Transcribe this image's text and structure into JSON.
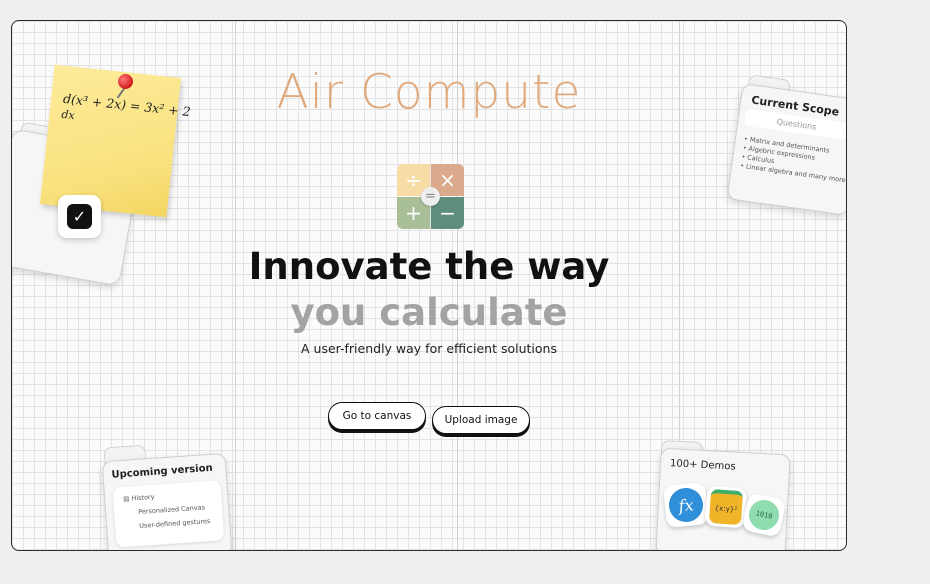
{
  "app": {
    "title": "Air Compute",
    "headline_line1": "Innovate the way",
    "headline_line2": "you calculate",
    "subtitle": "A user-friendly way  for efficient solutions"
  },
  "buttons": {
    "canvas": "Go to canvas",
    "upload": "Upload image"
  },
  "sticky_note": {
    "formula": "d(x³ + 2x) = 3x² + 2",
    "formula_den": "dx"
  },
  "logo": {
    "symbols": [
      "÷",
      "×",
      "+",
      "−",
      "="
    ]
  },
  "scope_card": {
    "title": "Current Scope",
    "tab_label": "Questions",
    "items": [
      "Matrix and determinants",
      "Algebric expressions",
      "Calculus",
      "Linear algebra and many more"
    ]
  },
  "upcoming_card": {
    "title": "Upcoming version",
    "items": [
      "History",
      "Personalized Canvas",
      "User-defined gestures"
    ]
  },
  "demos_card": {
    "title": "100+ Demos",
    "icons": [
      "fx",
      "{x:y}²",
      "1010"
    ]
  },
  "colors": {
    "title": "#dfa97c",
    "logo_q1": "#f7dca6",
    "logo_q2": "#dba98b",
    "logo_q3": "#a9bf98",
    "logo_q4": "#5f8e7e",
    "headline_secondary": "#a3a3a3"
  },
  "icons": [
    "pin-icon",
    "checkmark-icon",
    "history-icon",
    "fx-icon",
    "equation-icon",
    "binary-icon"
  ]
}
